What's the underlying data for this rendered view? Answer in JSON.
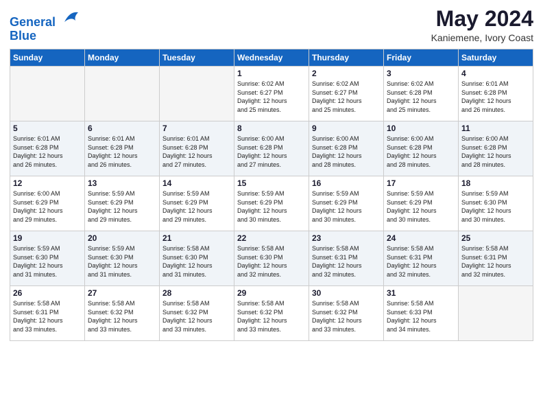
{
  "header": {
    "logo_line1": "General",
    "logo_line2": "Blue",
    "month_year": "May 2024",
    "location": "Kaniemene, Ivory Coast"
  },
  "weekdays": [
    "Sunday",
    "Monday",
    "Tuesday",
    "Wednesday",
    "Thursday",
    "Friday",
    "Saturday"
  ],
  "weeks": [
    [
      {
        "day": "",
        "info": ""
      },
      {
        "day": "",
        "info": ""
      },
      {
        "day": "",
        "info": ""
      },
      {
        "day": "1",
        "info": "Sunrise: 6:02 AM\nSunset: 6:27 PM\nDaylight: 12 hours\nand 25 minutes."
      },
      {
        "day": "2",
        "info": "Sunrise: 6:02 AM\nSunset: 6:27 PM\nDaylight: 12 hours\nand 25 minutes."
      },
      {
        "day": "3",
        "info": "Sunrise: 6:02 AM\nSunset: 6:28 PM\nDaylight: 12 hours\nand 25 minutes."
      },
      {
        "day": "4",
        "info": "Sunrise: 6:01 AM\nSunset: 6:28 PM\nDaylight: 12 hours\nand 26 minutes."
      }
    ],
    [
      {
        "day": "5",
        "info": "Sunrise: 6:01 AM\nSunset: 6:28 PM\nDaylight: 12 hours\nand 26 minutes."
      },
      {
        "day": "6",
        "info": "Sunrise: 6:01 AM\nSunset: 6:28 PM\nDaylight: 12 hours\nand 26 minutes."
      },
      {
        "day": "7",
        "info": "Sunrise: 6:01 AM\nSunset: 6:28 PM\nDaylight: 12 hours\nand 27 minutes."
      },
      {
        "day": "8",
        "info": "Sunrise: 6:00 AM\nSunset: 6:28 PM\nDaylight: 12 hours\nand 27 minutes."
      },
      {
        "day": "9",
        "info": "Sunrise: 6:00 AM\nSunset: 6:28 PM\nDaylight: 12 hours\nand 28 minutes."
      },
      {
        "day": "10",
        "info": "Sunrise: 6:00 AM\nSunset: 6:28 PM\nDaylight: 12 hours\nand 28 minutes."
      },
      {
        "day": "11",
        "info": "Sunrise: 6:00 AM\nSunset: 6:28 PM\nDaylight: 12 hours\nand 28 minutes."
      }
    ],
    [
      {
        "day": "12",
        "info": "Sunrise: 6:00 AM\nSunset: 6:29 PM\nDaylight: 12 hours\nand 29 minutes."
      },
      {
        "day": "13",
        "info": "Sunrise: 5:59 AM\nSunset: 6:29 PM\nDaylight: 12 hours\nand 29 minutes."
      },
      {
        "day": "14",
        "info": "Sunrise: 5:59 AM\nSunset: 6:29 PM\nDaylight: 12 hours\nand 29 minutes."
      },
      {
        "day": "15",
        "info": "Sunrise: 5:59 AM\nSunset: 6:29 PM\nDaylight: 12 hours\nand 30 minutes."
      },
      {
        "day": "16",
        "info": "Sunrise: 5:59 AM\nSunset: 6:29 PM\nDaylight: 12 hours\nand 30 minutes."
      },
      {
        "day": "17",
        "info": "Sunrise: 5:59 AM\nSunset: 6:29 PM\nDaylight: 12 hours\nand 30 minutes."
      },
      {
        "day": "18",
        "info": "Sunrise: 5:59 AM\nSunset: 6:30 PM\nDaylight: 12 hours\nand 30 minutes."
      }
    ],
    [
      {
        "day": "19",
        "info": "Sunrise: 5:59 AM\nSunset: 6:30 PM\nDaylight: 12 hours\nand 31 minutes."
      },
      {
        "day": "20",
        "info": "Sunrise: 5:59 AM\nSunset: 6:30 PM\nDaylight: 12 hours\nand 31 minutes."
      },
      {
        "day": "21",
        "info": "Sunrise: 5:58 AM\nSunset: 6:30 PM\nDaylight: 12 hours\nand 31 minutes."
      },
      {
        "day": "22",
        "info": "Sunrise: 5:58 AM\nSunset: 6:30 PM\nDaylight: 12 hours\nand 32 minutes."
      },
      {
        "day": "23",
        "info": "Sunrise: 5:58 AM\nSunset: 6:31 PM\nDaylight: 12 hours\nand 32 minutes."
      },
      {
        "day": "24",
        "info": "Sunrise: 5:58 AM\nSunset: 6:31 PM\nDaylight: 12 hours\nand 32 minutes."
      },
      {
        "day": "25",
        "info": "Sunrise: 5:58 AM\nSunset: 6:31 PM\nDaylight: 12 hours\nand 32 minutes."
      }
    ],
    [
      {
        "day": "26",
        "info": "Sunrise: 5:58 AM\nSunset: 6:31 PM\nDaylight: 12 hours\nand 33 minutes."
      },
      {
        "day": "27",
        "info": "Sunrise: 5:58 AM\nSunset: 6:32 PM\nDaylight: 12 hours\nand 33 minutes."
      },
      {
        "day": "28",
        "info": "Sunrise: 5:58 AM\nSunset: 6:32 PM\nDaylight: 12 hours\nand 33 minutes."
      },
      {
        "day": "29",
        "info": "Sunrise: 5:58 AM\nSunset: 6:32 PM\nDaylight: 12 hours\nand 33 minutes."
      },
      {
        "day": "30",
        "info": "Sunrise: 5:58 AM\nSunset: 6:32 PM\nDaylight: 12 hours\nand 33 minutes."
      },
      {
        "day": "31",
        "info": "Sunrise: 5:58 AM\nSunset: 6:33 PM\nDaylight: 12 hours\nand 34 minutes."
      },
      {
        "day": "",
        "info": ""
      }
    ]
  ]
}
